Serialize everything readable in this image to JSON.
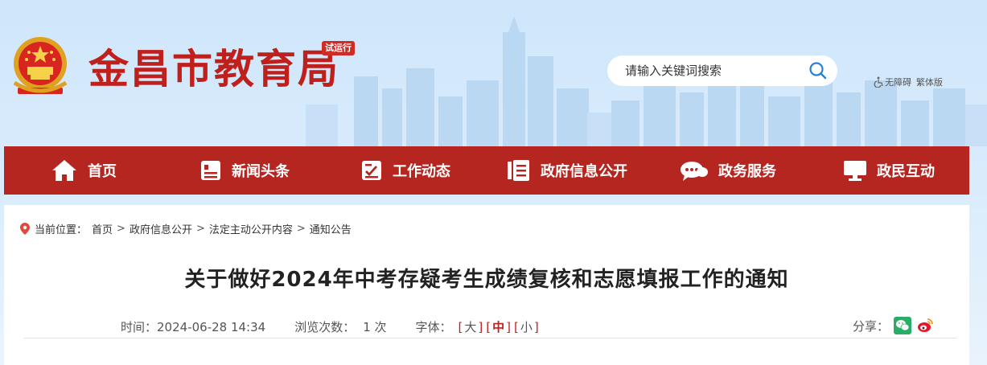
{
  "header": {
    "site_title": "金昌市教育局",
    "badge": "试运行",
    "search": {
      "placeholder": "请输入关键词搜索"
    },
    "accessibility_label": "无障碍",
    "traditional_label": "繁体版"
  },
  "nav": {
    "items": [
      {
        "label": "首页",
        "icon": "home-icon"
      },
      {
        "label": "新闻头条",
        "icon": "news-icon"
      },
      {
        "label": "工作动态",
        "icon": "work-icon"
      },
      {
        "label": "政府信息公开",
        "icon": "info-icon"
      },
      {
        "label": "政务服务",
        "icon": "chat-icon"
      },
      {
        "label": "政民互动",
        "icon": "monitor-icon"
      }
    ]
  },
  "breadcrumb": {
    "prefix": "当前位置：",
    "items": [
      "首页",
      "政府信息公开",
      "法定主动公开内容",
      "通知公告"
    ],
    "separator": ">"
  },
  "article": {
    "title": "关于做好2024年中考存疑考生成绩复核和志愿填报工作的通知",
    "time_label": "时间：",
    "time_value": "2024-06-28 14:34",
    "views_label": "浏览次数：",
    "views_value": "1 次",
    "font_label": "字体：",
    "font_sizes": [
      "大",
      "中",
      "小"
    ],
    "font_active": "中",
    "share_label": "分享："
  },
  "colors": {
    "brand_red": "#b52620",
    "title_red": "#c0201b",
    "wechat_green": "#2aae67",
    "weibo_red": "#e6162d"
  }
}
